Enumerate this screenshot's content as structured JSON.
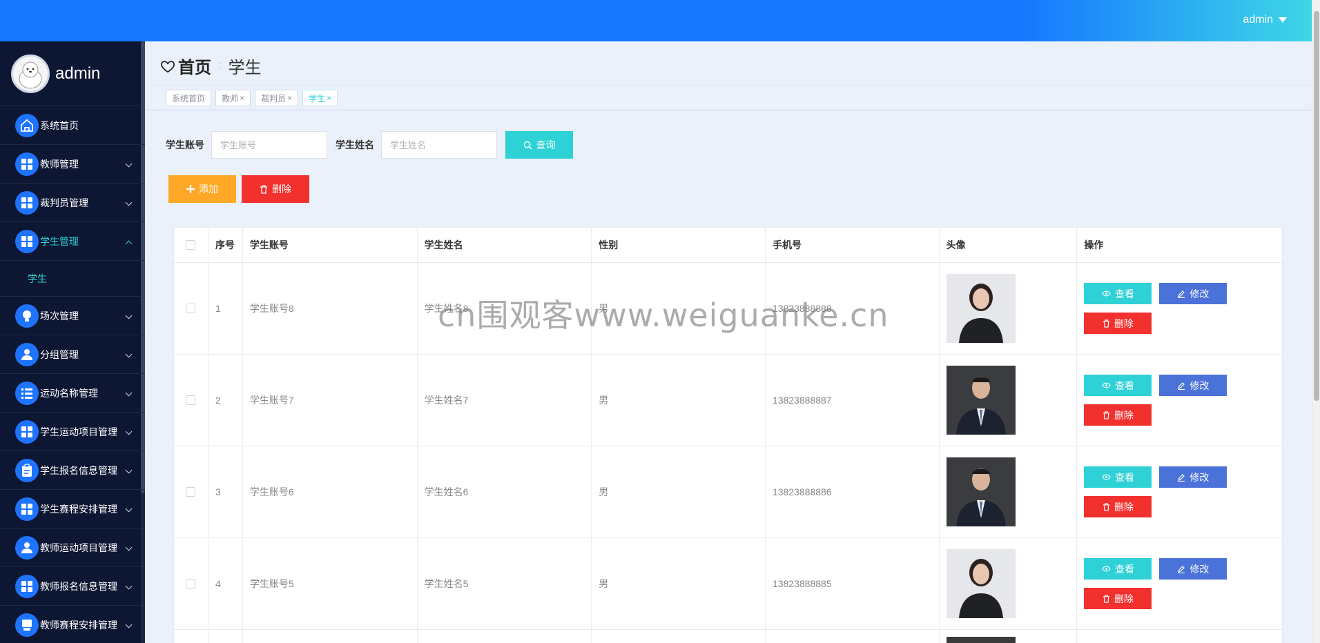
{
  "topbar": {
    "user": "admin"
  },
  "sidebar": {
    "profile_name": "admin",
    "items": [
      {
        "label": "系统首页",
        "icon": "home-icon",
        "has_children": false
      },
      {
        "label": "教师管理",
        "icon": "grid-icon",
        "has_children": true
      },
      {
        "label": "裁判员管理",
        "icon": "grid-icon",
        "has_children": true
      },
      {
        "label": "学生管理",
        "icon": "grid-icon",
        "has_children": true,
        "active": true
      },
      {
        "label": "场次管理",
        "icon": "bulb-icon",
        "has_children": true
      },
      {
        "label": "分组管理",
        "icon": "user-icon",
        "has_children": true
      },
      {
        "label": "运动名称管理",
        "icon": "list-icon",
        "has_children": true
      },
      {
        "label": "学生运动项目管理",
        "icon": "grid-icon",
        "has_children": true
      },
      {
        "label": "学生报名信息管理",
        "icon": "clipboard-icon",
        "has_children": true
      },
      {
        "label": "学生赛程安排管理",
        "icon": "grid-icon",
        "has_children": true
      },
      {
        "label": "教师运动项目管理",
        "icon": "user-icon",
        "has_children": true
      },
      {
        "label": "教师报名信息管理",
        "icon": "grid-icon",
        "has_children": true
      },
      {
        "label": "教师赛程安排管理",
        "icon": "doc-icon",
        "has_children": true
      }
    ],
    "submenu_label": "学生"
  },
  "breadcrumb": {
    "home": "首页",
    "current": "学生"
  },
  "tags": [
    {
      "label": "系统首页",
      "closable": false
    },
    {
      "label": "教师",
      "closable": true
    },
    {
      "label": "裁判员",
      "closable": true
    },
    {
      "label": "学生",
      "closable": true,
      "active": true
    }
  ],
  "search": {
    "account_label": "学生账号",
    "account_placeholder": "学生账号",
    "name_label": "学生姓名",
    "name_placeholder": "学生姓名",
    "query_button": "查询"
  },
  "actions": {
    "add": "添加",
    "delete": "删除"
  },
  "table": {
    "columns": [
      "序号",
      "学生账号",
      "学生姓名",
      "性别",
      "手机号",
      "头像",
      "操作"
    ],
    "rows": [
      {
        "no": "1",
        "account": "学生账号8",
        "name": "学生姓名8",
        "sex": "男",
        "phone": "13823888888",
        "photo": "female-portrait"
      },
      {
        "no": "2",
        "account": "学生账号7",
        "name": "学生姓名7",
        "sex": "男",
        "phone": "13823888887",
        "photo": "male-portrait"
      },
      {
        "no": "3",
        "account": "学生账号6",
        "name": "学生姓名6",
        "sex": "男",
        "phone": "13823888886",
        "photo": "male-portrait"
      },
      {
        "no": "4",
        "account": "学生账号5",
        "name": "学生姓名5",
        "sex": "男",
        "phone": "13823888885",
        "photo": "female-portrait"
      }
    ],
    "ops": {
      "view": "查看",
      "edit": "修改",
      "remove": "删除"
    }
  },
  "watermark": "cn围观客www.weiguanke.cn"
}
